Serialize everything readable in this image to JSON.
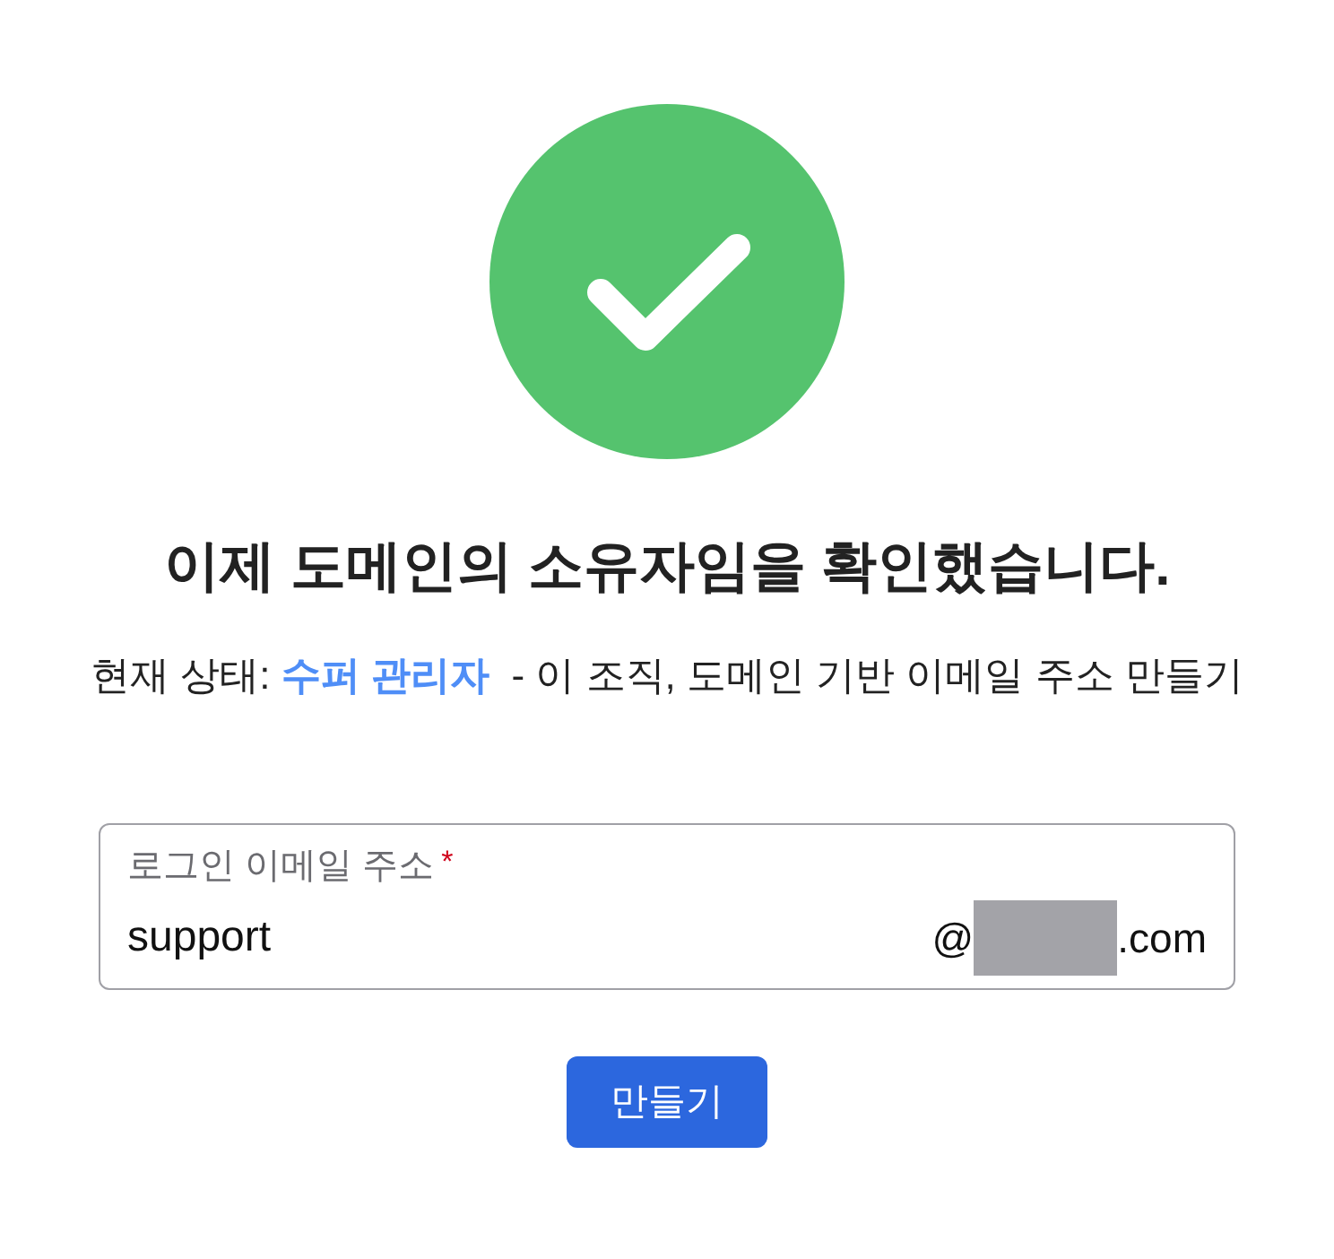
{
  "heading": "이제 도메인의 소유자임을 확인했습니다.",
  "status_line": {
    "prefix": "현재 상태:",
    "role": "수퍼 관리자",
    "description": "- 이 조직, 도메인 기반 이메일 주소 만들기"
  },
  "email_field": {
    "label": "로그인 이메일 주소",
    "required_mark": "*",
    "value": "support",
    "domain": {
      "at": "@",
      "redacted": true,
      "suffix": ".com"
    }
  },
  "create_button": {
    "label": "만들기"
  }
}
